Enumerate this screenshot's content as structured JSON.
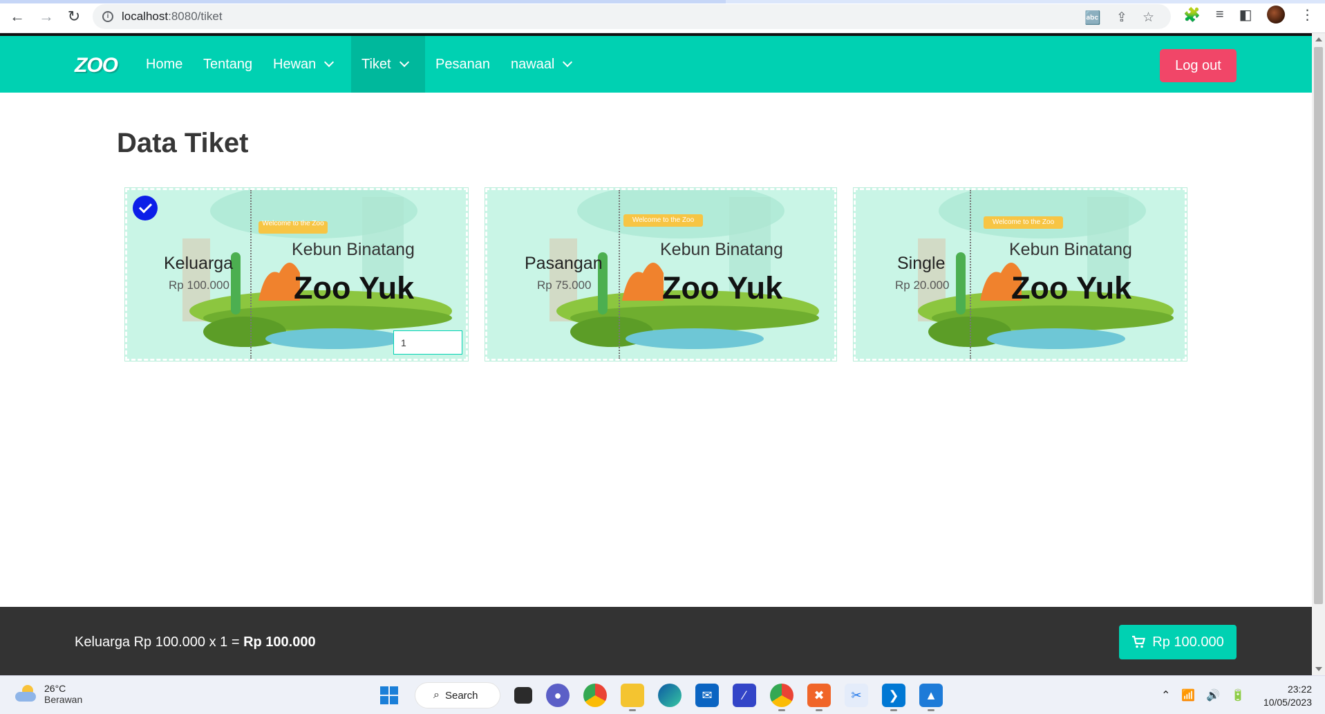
{
  "browser": {
    "url_host": "localhost",
    "url_rest": ":8080/tiket"
  },
  "navbar": {
    "logo": "ZOO",
    "items": [
      {
        "label": "Home"
      },
      {
        "label": "Tentang"
      },
      {
        "label": "Hewan"
      },
      {
        "label": "Tiket"
      },
      {
        "label": "Pesanan"
      },
      {
        "label": "nawaal"
      }
    ],
    "logout_label": "Log out",
    "accent": "#00d1b2",
    "logout_color": "#f14668"
  },
  "page": {
    "title": "Data Tiket"
  },
  "tickets": [
    {
      "name": "Keluarga",
      "price": "Rp 100.000",
      "banner": "Welcome to the Zoo",
      "subtitle": "Kebun Binatang",
      "brand": "Zoo Yuk",
      "selected": true,
      "quantity": "1"
    },
    {
      "name": "Pasangan",
      "price": "Rp 75.000",
      "banner": "Welcome to the Zoo",
      "subtitle": "Kebun Binatang",
      "brand": "Zoo Yuk",
      "selected": false
    },
    {
      "name": "Single",
      "price": "Rp 20.000",
      "banner": "Welcome to the Zoo",
      "subtitle": "Kebun Binatang",
      "brand": "Zoo Yuk",
      "selected": false
    }
  ],
  "footer": {
    "summary_prefix": "Keluarga Rp 100.000 x 1 = ",
    "summary_total": "Rp 100.000",
    "cart_label": "Rp 100.000"
  },
  "taskbar": {
    "temperature": "26°C",
    "condition": "Berawan",
    "search_label": "Search",
    "time": "23:22",
    "date": "10/05/2023"
  }
}
